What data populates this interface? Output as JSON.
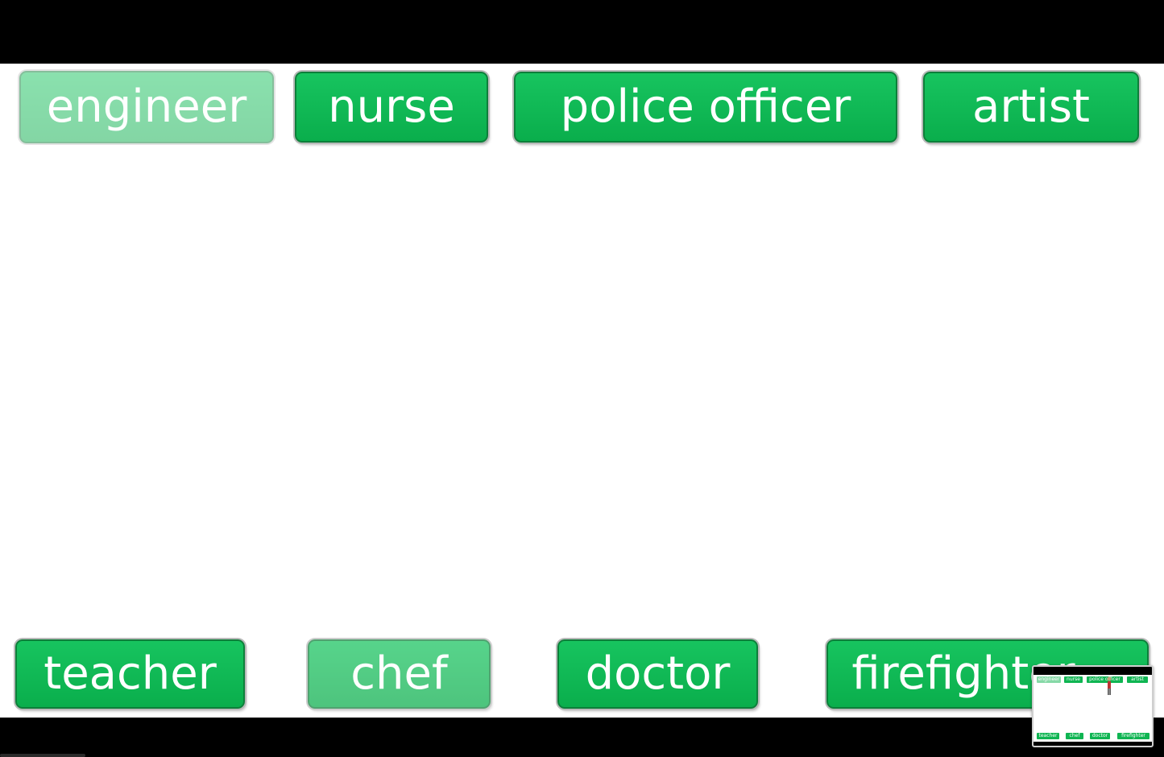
{
  "words_top": [
    {
      "label": "engineer",
      "state": "faded"
    },
    {
      "label": "nurse",
      "state": "normal"
    },
    {
      "label": "police officer",
      "state": "normal"
    },
    {
      "label": "artist",
      "state": "normal"
    }
  ],
  "words_bottom": [
    {
      "label": "teacher",
      "state": "normal"
    },
    {
      "label": "chef",
      "state": "semi-faded"
    },
    {
      "label": "doctor",
      "state": "normal"
    },
    {
      "label": "firefighter",
      "state": "normal"
    }
  ],
  "thumbnail": {
    "words_top": [
      "engineer",
      "nurse",
      "police officer",
      "artist"
    ],
    "words_bottom": [
      "teacher",
      "chef",
      "doctor",
      "firefighter"
    ]
  },
  "colors": {
    "button_green": "#0fb552",
    "button_border": "#0d7f3a",
    "letterbox": "#000000",
    "stage": "#ffffff"
  }
}
